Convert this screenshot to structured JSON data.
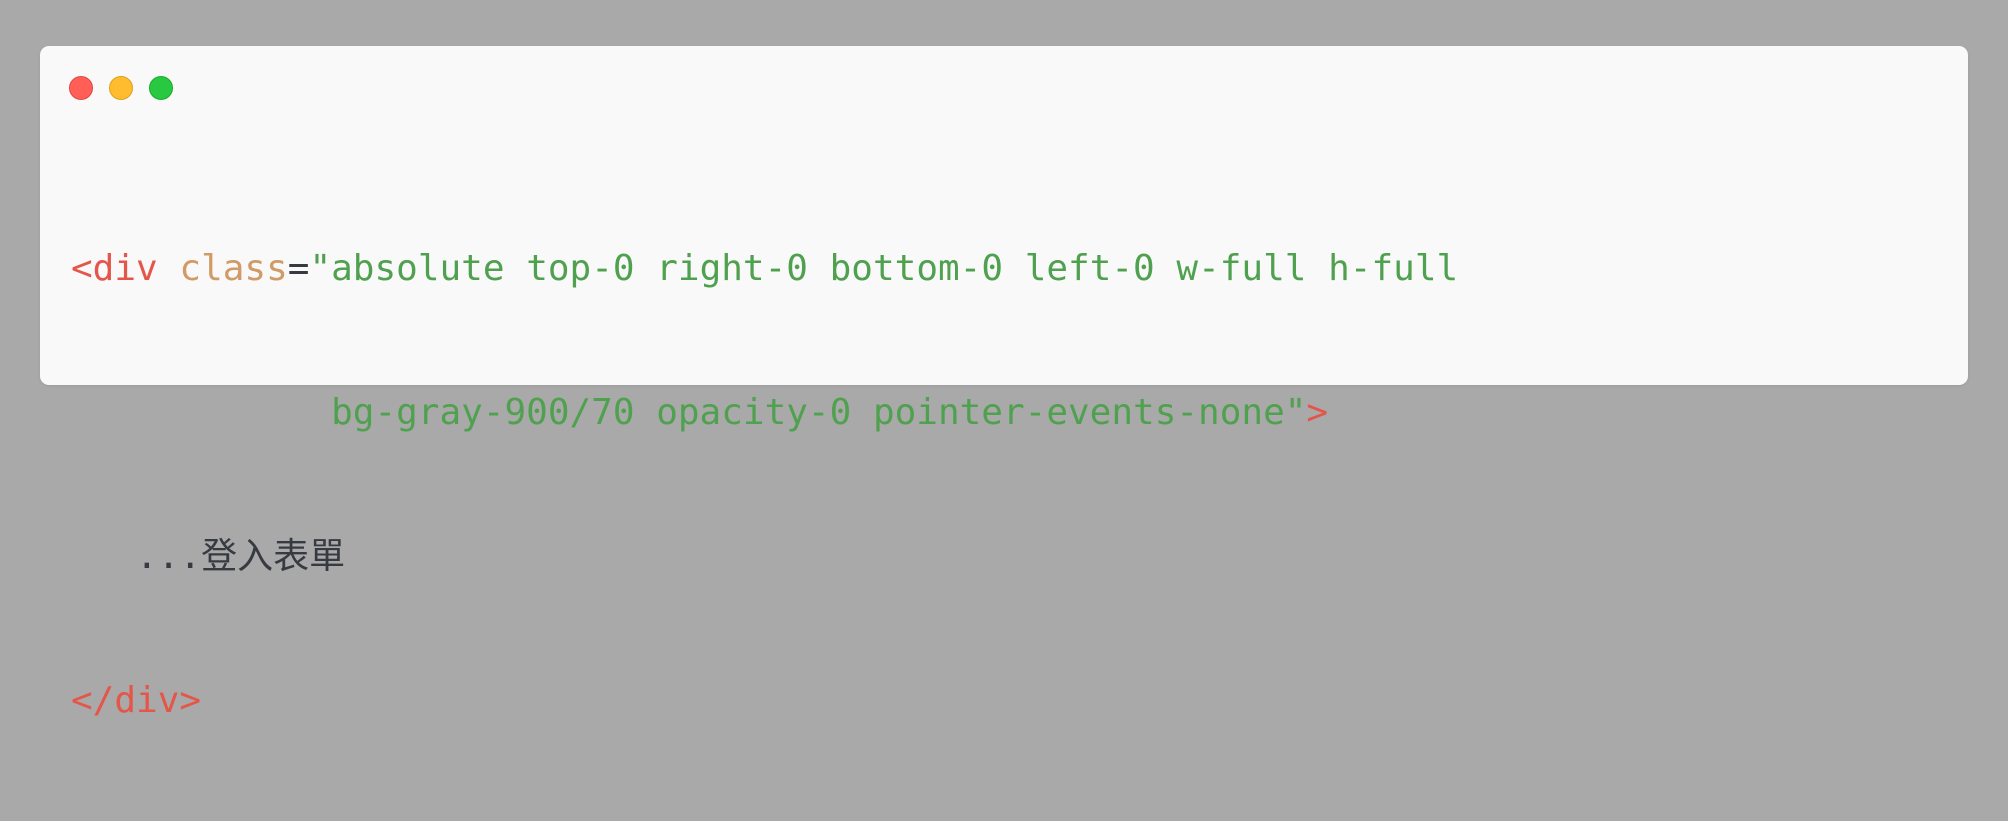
{
  "window": {
    "controls": {
      "close_color": "#ff5f57",
      "minimize_color": "#febc2e",
      "maximize_color": "#28c840"
    }
  },
  "code": {
    "line1": {
      "tag_open": "<div",
      "space": " ",
      "attr_name": "class",
      "eq": "=",
      "string": "\"absolute top-0 right-0 bottom-0 left-0 w-full h-full"
    },
    "line2": {
      "indent": "            ",
      "string": "bg-gray-900/70 opacity-0 pointer-events-none\"",
      "tag_close": ">"
    },
    "line3": {
      "indent": "   ",
      "text": "...",
      "cjk_text": "登入表單"
    },
    "line4": {
      "tag_end": "</div>"
    }
  },
  "colors": {
    "tag": "#e45649",
    "attr": "#d19a66",
    "string": "#50a14f",
    "text": "#383a42",
    "background": "#a9a9a9",
    "window": "#f9f9f9"
  }
}
